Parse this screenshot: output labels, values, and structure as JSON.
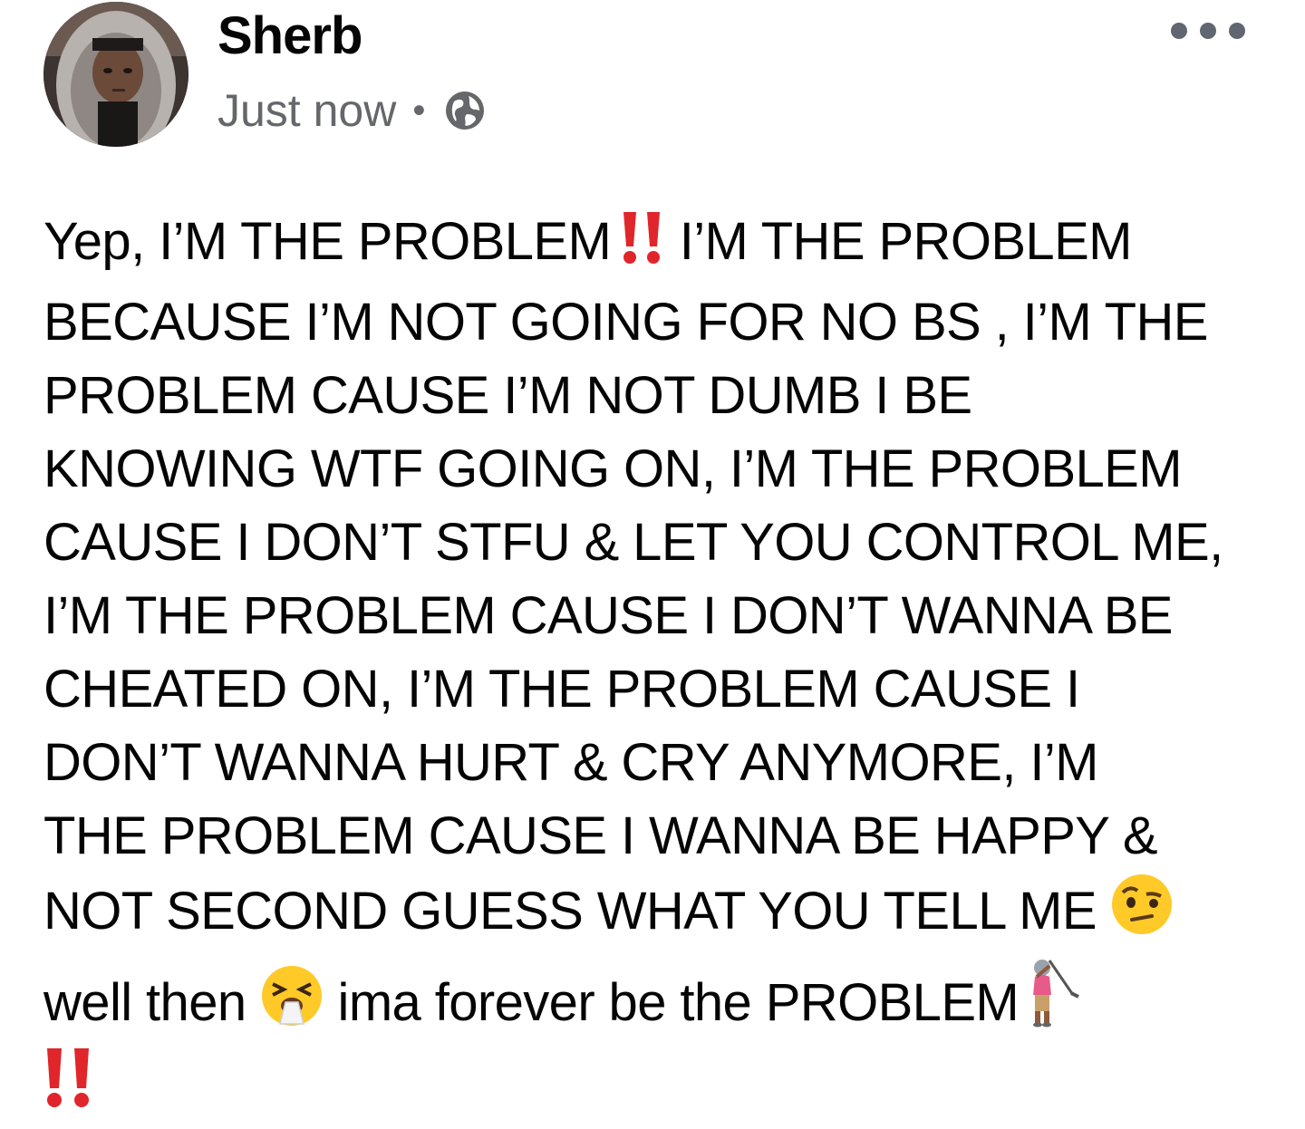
{
  "post": {
    "author": "Sherb",
    "timestamp": "Just now",
    "separator": "•",
    "audience_icon": "globe-icon",
    "more_icon": "more-options-icon",
    "lines": [
      "Yep, I’M THE PROBLEM",
      " I’M THE PROBLEM",
      "BECAUSE I’M NOT GOING FOR NO BS , I’M THE",
      "PROBLEM CAUSE I’M NOT DUMB I BE",
      "KNOWING WTF GOING ON, I’M THE PROBLEM",
      "CAUSE I DON’T STFU & LET YOU CONTROL ME,",
      "I’M THE PROBLEM CAUSE I DON’T WANNA BE",
      "CHEATED ON, I’M THE PROBLEM CAUSE I",
      "DON’T WANNA HURT & CRY ANYMORE, I’M",
      "THE PROBLEM CAUSE I WANNA BE HAPPY &",
      "NOT SECOND GUESS WHAT YOU TELL ME ",
      "well then ",
      " ima forever be the PROBLEM"
    ],
    "emojis": {
      "double_exclamation": "double-exclamation-icon",
      "raised_eyebrow": "raised-eyebrow-face-icon",
      "sneezing": "sneezing-face-icon",
      "golfer": "woman-golfing-icon"
    }
  },
  "colors": {
    "text": "#050505",
    "meta": "#65676b",
    "more_dots": "#606770",
    "exclamation": "#e0262a",
    "emoji_face": "#ffca28"
  }
}
